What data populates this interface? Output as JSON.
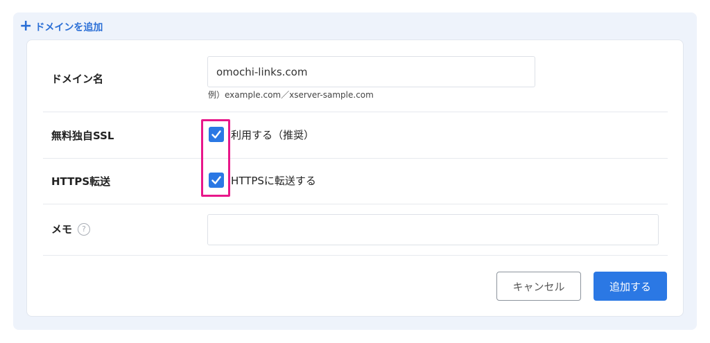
{
  "header": {
    "add_domain_plus": "+",
    "add_domain_label": "ドメインを追加"
  },
  "form": {
    "domain": {
      "label": "ドメイン名",
      "value": "omochi-links.com",
      "hint": "例）example.com／xserver-sample.com"
    },
    "ssl": {
      "label": "無料独自SSL",
      "checkbox_label": "利用する（推奨）",
      "checked": true
    },
    "https": {
      "label": "HTTPS転送",
      "checkbox_label": "HTTPSに転送する",
      "checked": true
    },
    "memo": {
      "label": "メモ",
      "help_glyph": "?",
      "value": ""
    }
  },
  "actions": {
    "cancel_label": "キャンセル",
    "submit_label": "追加する"
  },
  "colors": {
    "accent": "#2b78e4",
    "link": "#2b6fd6",
    "highlight": "#e8178a",
    "panel_bg": "#eef3fb"
  },
  "icons": [
    "plus-icon",
    "checkmark-icon",
    "help-icon"
  ]
}
